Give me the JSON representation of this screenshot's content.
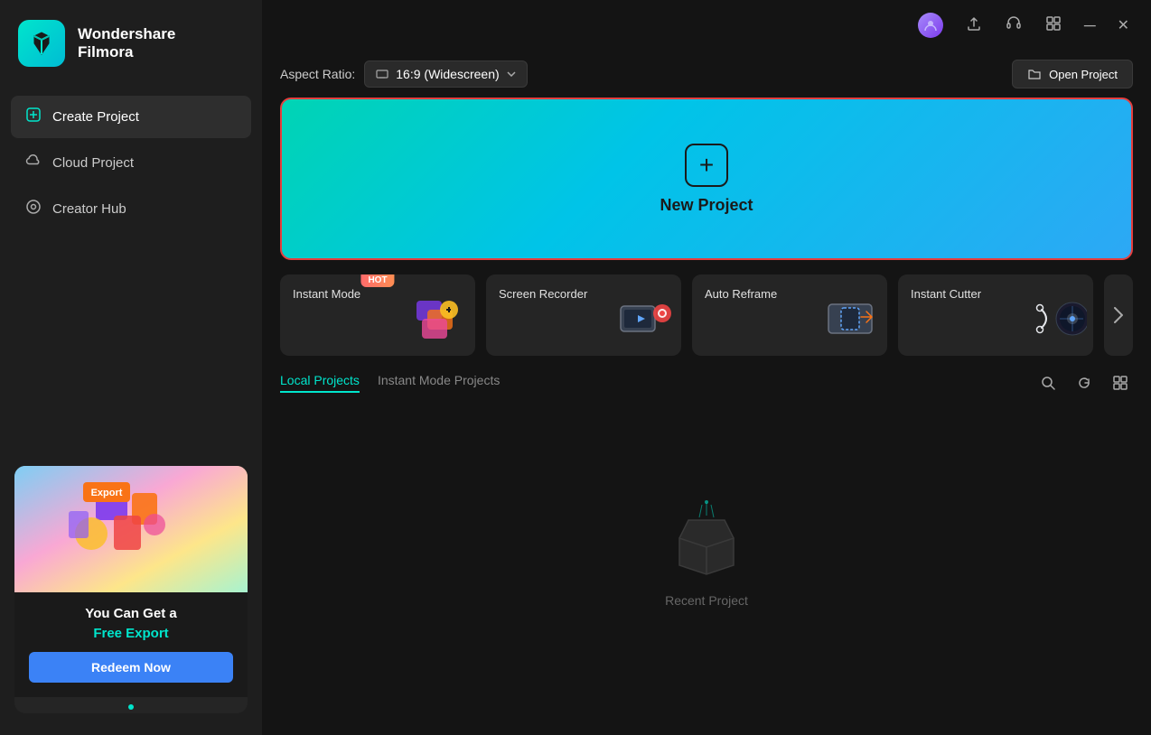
{
  "app": {
    "name": "Wondershare",
    "name2": "Filmora"
  },
  "titlebar": {
    "minimize_label": "─",
    "maximize_label": "⊟",
    "close_label": "✕",
    "upload_icon": "upload-icon",
    "headset_icon": "headset-icon",
    "grid_icon": "grid-icon"
  },
  "header": {
    "aspect_ratio_label": "Aspect Ratio:",
    "aspect_ratio_value": "16:9 (Widescreen)",
    "open_project_label": "Open Project"
  },
  "sidebar": {
    "items": [
      {
        "id": "create-project",
        "label": "Create Project",
        "icon": "➕",
        "active": true
      },
      {
        "id": "cloud-project",
        "label": "Cloud Project",
        "icon": "☁",
        "active": false
      },
      {
        "id": "creator-hub",
        "label": "Creator Hub",
        "icon": "💡",
        "active": false
      }
    ]
  },
  "new_project": {
    "label": "New Project",
    "plus_icon": "+"
  },
  "feature_cards": [
    {
      "id": "instant-mode",
      "label": "Instant Mode",
      "hot": true,
      "icon": "🎬"
    },
    {
      "id": "screen-recorder",
      "label": "Screen Recorder",
      "hot": false,
      "icon": "📹"
    },
    {
      "id": "auto-reframe",
      "label": "Auto Reframe",
      "hot": false,
      "icon": "🎯"
    },
    {
      "id": "instant-cutter",
      "label": "Instant Cutter",
      "hot": false,
      "icon": "✂️"
    }
  ],
  "projects": {
    "tabs": [
      {
        "id": "local",
        "label": "Local Projects",
        "active": true
      },
      {
        "id": "instant-mode",
        "label": "Instant Mode Projects",
        "active": false
      }
    ],
    "empty_label": "Recent Project",
    "actions": {
      "search": "🔍",
      "refresh": "↻",
      "grid": "⊞"
    }
  },
  "ad": {
    "title": "You Can Get a",
    "subtitle": "Free Export",
    "button_label": "Redeem Now",
    "export_badge": "Export"
  },
  "colors": {
    "accent": "#00e5cc",
    "bg_sidebar": "#1e1e1e",
    "bg_main": "#141414",
    "active_nav": "#2e2e2e",
    "card_bg": "#252525",
    "hot_badge": "#ff6b6b",
    "border_red": "#e53e3e"
  }
}
